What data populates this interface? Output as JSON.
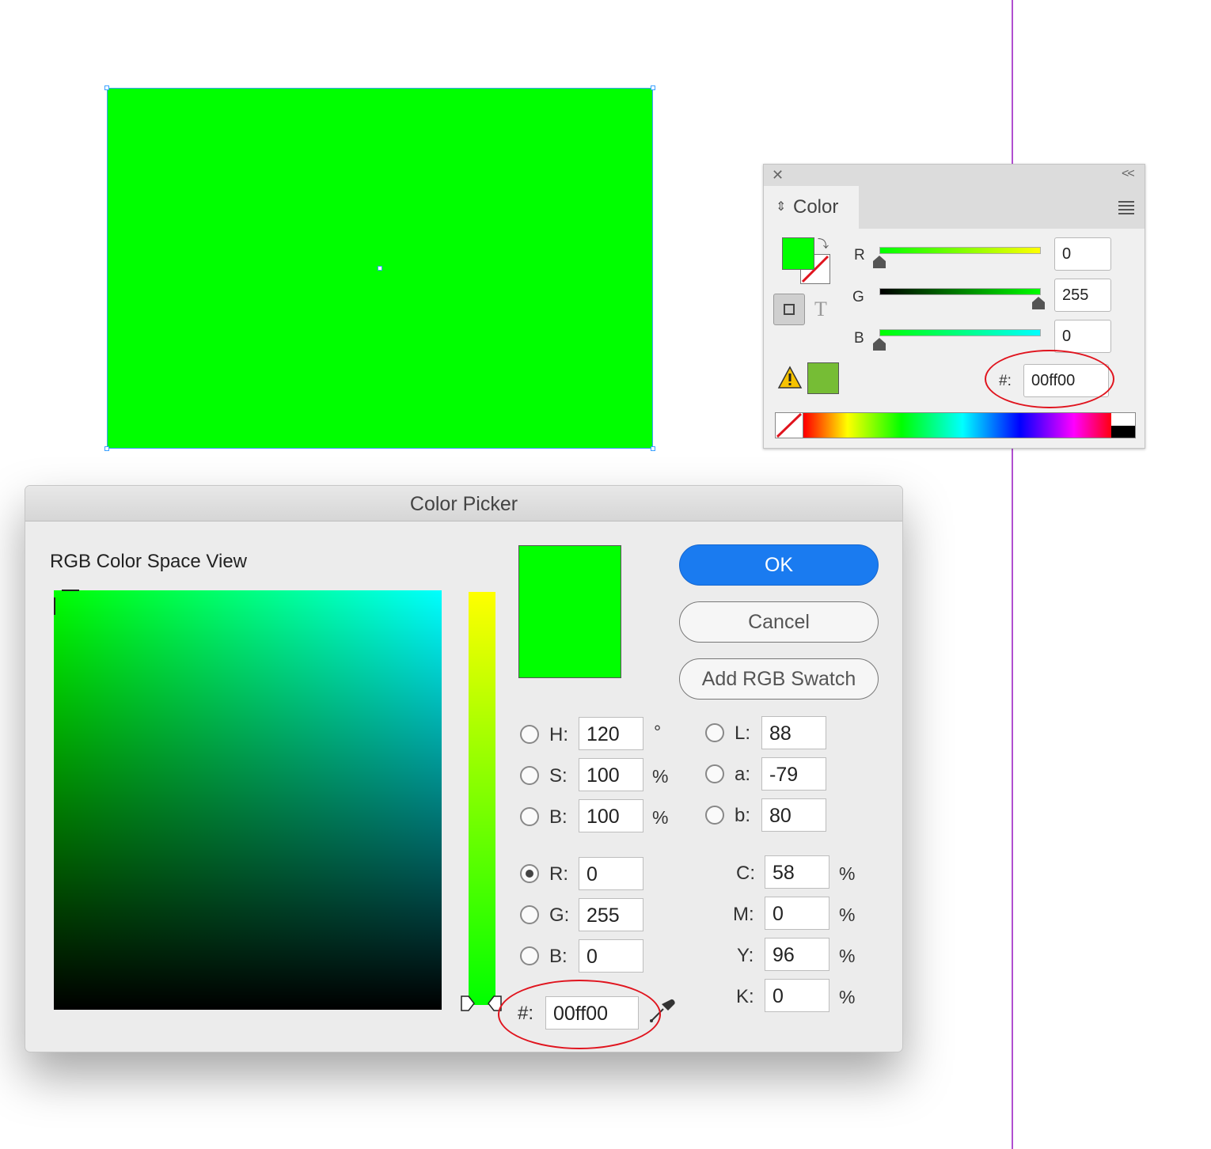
{
  "document": {
    "fill_color": "#00ff00",
    "guide_color": "#b04fd0"
  },
  "color_panel": {
    "title": "Color",
    "close_icon": "close-icon",
    "collapse_label": "<<",
    "r": {
      "label": "R",
      "value": "0"
    },
    "g": {
      "label": "G",
      "value": "255"
    },
    "b": {
      "label": "B",
      "value": "0"
    },
    "hex_label": "#:",
    "hex_value": "00ff00",
    "type_glyph": "T",
    "fill_swatch_color": "#00ff00",
    "out_of_gamut_color": "#76bd35"
  },
  "color_picker": {
    "title": "Color Picker",
    "view_label": "RGB Color Space View",
    "buttons": {
      "ok": "OK",
      "cancel": "Cancel",
      "add_swatch": "Add RGB Swatch"
    },
    "hsb": [
      {
        "label": "H:",
        "value": "120",
        "unit": "°",
        "selected": false
      },
      {
        "label": "S:",
        "value": "100",
        "unit": "%",
        "selected": false
      },
      {
        "label": "B:",
        "value": "100",
        "unit": "%",
        "selected": false
      }
    ],
    "lab": [
      {
        "label": "L:",
        "value": "88",
        "selected": false
      },
      {
        "label": "a:",
        "value": "-79",
        "selected": false
      },
      {
        "label": "b:",
        "value": "80",
        "selected": false
      }
    ],
    "rgb": [
      {
        "label": "R:",
        "value": "0",
        "selected": true
      },
      {
        "label": "G:",
        "value": "255",
        "selected": false
      },
      {
        "label": "B:",
        "value": "0",
        "selected": false
      }
    ],
    "cmyk": [
      {
        "label": "C:",
        "value": "58",
        "unit": "%"
      },
      {
        "label": "M:",
        "value": "0",
        "unit": "%"
      },
      {
        "label": "Y:",
        "value": "96",
        "unit": "%"
      },
      {
        "label": "K:",
        "value": "0",
        "unit": "%"
      }
    ],
    "hex_label": "#:",
    "hex_value": "00ff00",
    "accent_color": "#1a7bf0",
    "annotation_color": "#e0141e"
  }
}
